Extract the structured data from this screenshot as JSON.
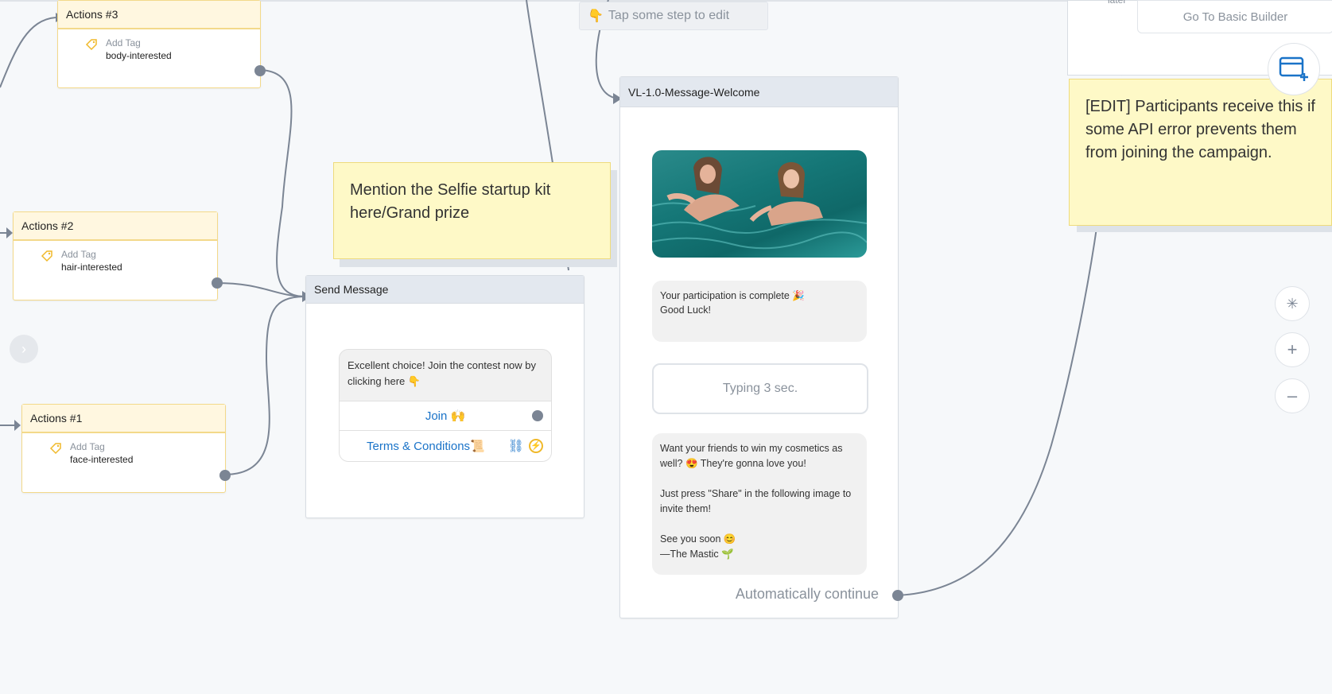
{
  "hint": {
    "text": "Tap some step to edit",
    "icon": "pointing-down-hand-icon"
  },
  "basic_builder": {
    "label": "Go To Basic Builder",
    "partial_text": "later"
  },
  "actions": [
    {
      "title": "Actions #3",
      "tag_action": "Add Tag",
      "tag_value": "body-interested"
    },
    {
      "title": "Actions #2",
      "tag_action": "Add Tag",
      "tag_value": "hair-interested"
    },
    {
      "title": "Actions #1",
      "tag_action": "Add Tag",
      "tag_value": "face-interested"
    }
  ],
  "send_message": {
    "title": "Send Message",
    "text": "Excellent choice! Join the contest now by clicking here 👇",
    "buttons": [
      {
        "label": "Join 🙌"
      },
      {
        "label": "Terms & Conditions📜"
      }
    ]
  },
  "welcome": {
    "title": "VL-1.0-Message-Welcome",
    "message1": "Your participation is complete 🎉\nGood Luck!",
    "typing": "Typing 3 sec.",
    "message2": "Want your friends to win my cosmetics as well? 😍 They're gonna love you!\n\nJust press \"Share\" in the following image to invite them!\n\nSee you soon 😊\n—The Mastic 🌱",
    "continue": "Automatically continue"
  },
  "notes": [
    {
      "text": "Mention the Selfie startup kit here/Grand prize"
    },
    {
      "text": "[EDIT] Participants receive this if some API error prevents them from joining the campaign."
    }
  ],
  "toolbar": {
    "magic": "✳",
    "zoom_in": "+",
    "zoom_out": "–"
  },
  "colors": {
    "accent": "#1a73c8",
    "port": "#7b8594",
    "sticky": "#fef9c7",
    "action_header": "#fff7e0"
  }
}
